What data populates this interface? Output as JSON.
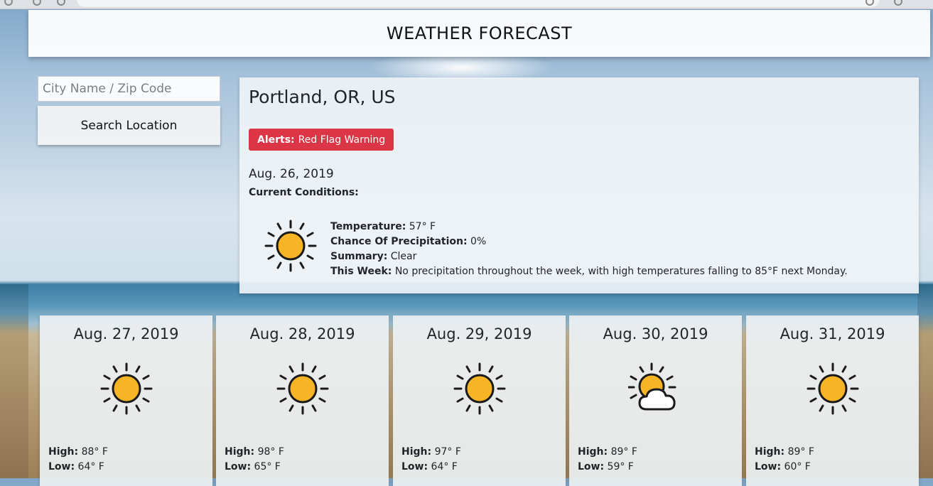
{
  "header": {
    "title": "WEATHER FORECAST"
  },
  "search": {
    "placeholder": "City Name / Zip Code",
    "value": "",
    "button_label": "Search Location"
  },
  "current": {
    "location": "Portland, OR, US",
    "alert": {
      "label": "Alerts:",
      "text": "Red Flag Warning",
      "color": "#dc3545"
    },
    "date": "Aug. 26, 2019",
    "conditions_label": "Current Conditions:",
    "icon": "sun-icon",
    "temperature_label": "Temperature:",
    "temperature": "57° F",
    "precip_label": "Chance Of Precipitation:",
    "precip": "0%",
    "summary_label": "Summary:",
    "summary": "Clear",
    "week_label": "This Week:",
    "week": "No precipitation throughout the week, with high temperatures falling to 85°F next Monday."
  },
  "forecast_labels": {
    "high": "High:",
    "low": "Low:"
  },
  "forecast": [
    {
      "date": "Aug. 27, 2019",
      "icon": "sun-icon",
      "high": "88° F",
      "low": "64° F"
    },
    {
      "date": "Aug. 28, 2019",
      "icon": "sun-icon",
      "high": "98° F",
      "low": "65° F"
    },
    {
      "date": "Aug. 29, 2019",
      "icon": "sun-icon",
      "high": "97° F",
      "low": "64° F"
    },
    {
      "date": "Aug. 30, 2019",
      "icon": "partly-cloudy-icon",
      "high": "89° F",
      "low": "59° F"
    },
    {
      "date": "Aug. 31, 2019",
      "icon": "sun-icon",
      "high": "89° F",
      "low": "60° F"
    }
  ],
  "colors": {
    "sun": "#f7b425",
    "outline": "#1a1a1a",
    "alert": "#dc3545"
  }
}
